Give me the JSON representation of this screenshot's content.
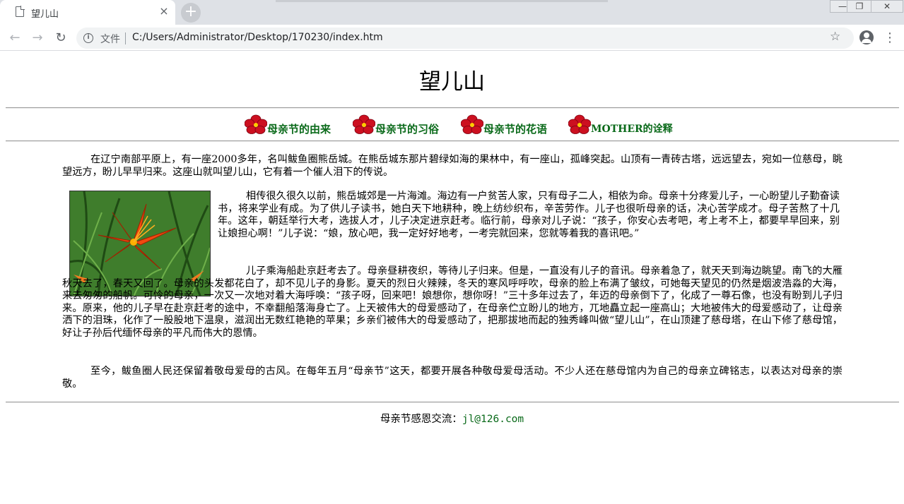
{
  "browser": {
    "tab_title": "望儿山",
    "tab_close": "×",
    "new_tab": "+",
    "omnibox_label": "文件",
    "url": "C:/Users/Administrator/Desktop/170230/index.htm",
    "back": "←",
    "forward": "→",
    "reload": "↻",
    "star": "☆",
    "menu": "⋮",
    "win_min": "—",
    "win_max": "❐",
    "win_close": "✕"
  },
  "page": {
    "title": "望儿山",
    "nav": [
      {
        "label": "母亲节的由来"
      },
      {
        "label": "母亲节的习俗"
      },
      {
        "label": "母亲节的花语"
      },
      {
        "label": "MOTHER的诠释"
      }
    ],
    "paragraphs": [
      "在辽宁南部平原上，有一座2000多年，名叫鲅鱼圈熊岳城。在熊岳城东那片碧绿如海的果林中，有一座山，孤峰突起。山顶有一青砖古塔，远远望去，宛如一位慈母，眺望远方，盼儿早早归来。这座山就叫望儿山，它有着一个催人泪下的传说。",
      "相传很久很久以前，熊岳城郊是一片海滩。海边有一户贫苦人家，只有母子二人，相依为命。母亲十分疼爱儿子，一心盼望儿子勤奋读书，将来学业有成。为了供儿子读书，她白天下地耕种，晚上纺纱织布，辛苦劳作。儿子也很听母亲的话，决心苦学成才。母子苦熬了十几年。这年，朝廷举行大考，选拔人才，儿子决定进京赶考。临行前，母亲对儿子说：“孩子，你安心去考吧，考上考不上，都要早早回来，别让娘担心啊！”儿子说：“娘，放心吧，我一定好好地考，一考完就回来，您就等着我的喜讯吧。”",
      "儿子乘海船赴京赶考去了。母亲昼耕夜织，等待儿子归来。但是，一直没有儿子的音讯。母亲着急了，就天天到海边眺望。南飞的大雁秋天去了，春天又回了。母亲的头发都花白了，却不见儿子的身影。夏天的烈日火辣辣，冬天的寒风呼呼吹，母亲的脸上布满了皱纹，可她每天望见的仍然是烟波浩淼的大海，来去匆匆的船帆。可怜的母亲，一次又一次地对着大海呼唤：“孩子呀，回来吧！娘想你，想你呀！”三十多年过去了，年迈的母亲倒下了，化成了一尊石像，也没有盼到儿子归来。原来，他的儿子早在赴京赶考的途中，不幸翻船落海身亡了。上天被伟大的母爱感动了，在母亲伫立盼儿的地方，兀地矗立起一座高山；大地被伟大的母爱感动了，让母亲洒下的泪珠，化作了一股股地下温泉，滋润出无数红艳艳的苹果；乡亲们被伟大的母爱感动了，把那拔地而起的独秀峰叫做“望儿山”，在山顶建了慈母塔，在山下修了慈母馆，好让子孙后代缅怀母亲的平凡而伟大的恩情。",
      "至今，鲅鱼圈人民还保留着敬母爱母的古风。在每年五月“母亲节”这天，都要开展各种敬母爱母活动。不少人还在慈母馆内为自己的母亲立碑铭志，以表达对母亲的崇敬。"
    ],
    "footer_label": "母亲节感恩交流：",
    "footer_email": "jl@126.com"
  },
  "colors": {
    "link": "#0a6a1a",
    "flower": "#cc1020",
    "lily": "#f04a10"
  }
}
